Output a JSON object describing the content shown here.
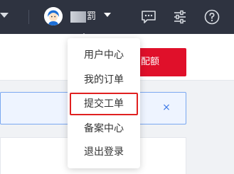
{
  "header": {
    "username_suffix": "罰",
    "icons": [
      "left-caret-icon",
      "user-avatar",
      "caret-down-icon",
      "message-icon",
      "settings-sliders-icon",
      "help-icon"
    ]
  },
  "main": {
    "red_button_label": "配额",
    "alert_close_glyph": "×"
  },
  "user_menu": {
    "items": [
      {
        "label": "用户中心"
      },
      {
        "label": "我的订单"
      },
      {
        "label": "提交工单",
        "highlighted": true
      },
      {
        "label": "备案中心"
      },
      {
        "label": "退出登录"
      }
    ]
  },
  "colors": {
    "topbar": "#2e3340",
    "accent_red": "#e0102a",
    "highlight_border": "#e02020",
    "alert_border": "#7aa7f0",
    "link_blue": "#3b78e7"
  }
}
